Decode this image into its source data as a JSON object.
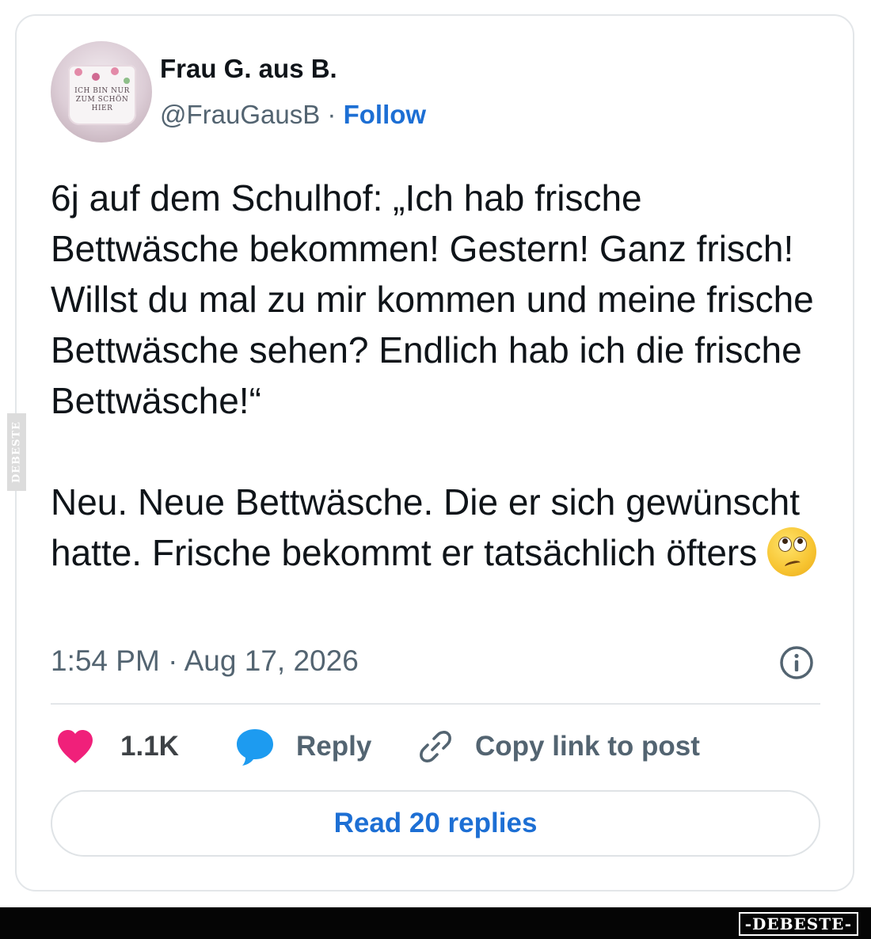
{
  "author": {
    "display_name": "Frau G. aus B.",
    "handle": "@FrauGausB",
    "separator": "·",
    "follow_label": "Follow",
    "avatar_mug_text": "ICH BIN NUR ZUM SCHÖN HIER"
  },
  "tweet": {
    "paragraph_1": "6j auf dem Schulhof: „Ich hab frische Bettwäsche bekommen! Gestern! Ganz frisch! Willst du mal zu mir kommen und meine frische Bettwäsche sehen? Endlich hab ich die frische Bettwäsche!“",
    "paragraph_2": "Neu. Neue Bettwäsche. Die er sich gewünscht hatte. Frische bekommt er tatsächlich öfters",
    "emoji": "face-with-rolling-eyes"
  },
  "timestamp": "1:54 PM · Aug 17, 2026",
  "actions": {
    "likes_count": "1.1K",
    "reply_label": "Reply",
    "copy_link_label": "Copy link to post"
  },
  "read_replies_label": "Read 20 replies",
  "watermarks": {
    "side": "DEBESTE",
    "footer": "-DEBESTE-"
  },
  "colors": {
    "link_blue": "#1d6fd4",
    "heart_pink": "#f0207a",
    "reply_blue": "#1d9bf0",
    "secondary_text": "#536471"
  }
}
